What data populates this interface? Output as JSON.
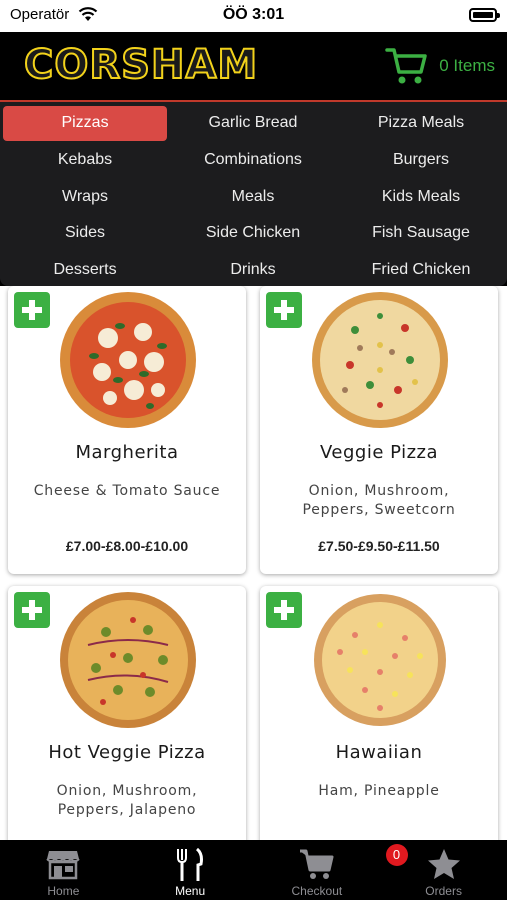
{
  "status_bar": {
    "carrier": "Operatör",
    "time": "ÖÖ 3:01"
  },
  "header": {
    "brand": "CORSHAM",
    "cart_count_text": "0 Items"
  },
  "categories": [
    {
      "label": "Pizzas",
      "active": true
    },
    {
      "label": "Garlic Bread"
    },
    {
      "label": "Pizza Meals"
    },
    {
      "label": "Kebabs"
    },
    {
      "label": "Combinations"
    },
    {
      "label": "Burgers"
    },
    {
      "label": "Wraps"
    },
    {
      "label": "Meals"
    },
    {
      "label": "Kids Meals"
    },
    {
      "label": "Sides"
    },
    {
      "label": "Side Chicken"
    },
    {
      "label": "Fish Sausage"
    },
    {
      "label": "Desserts"
    },
    {
      "label": "Drinks"
    },
    {
      "label": "Fried Chicken"
    }
  ],
  "products": [
    {
      "name": "Margherita",
      "description": "Cheese & Tomato Sauce",
      "price": "£7.00-£8.00-£10.00",
      "image": "margherita-pizza"
    },
    {
      "name": "Veggie Pizza",
      "description": "Onion, Mushroom, Peppers, Sweetcorn",
      "price": "£7.50-£9.50-£11.50",
      "image": "veggie-pizza"
    },
    {
      "name": "Hot Veggie Pizza",
      "description": "Onion, Mushroom, Peppers, Jalapeno",
      "price": "",
      "image": "hot-veggie-pizza"
    },
    {
      "name": "Hawaiian",
      "description": "Ham, Pineapple",
      "price": "",
      "image": "hawaiian-pizza"
    }
  ],
  "tab_bar": {
    "items": [
      {
        "label": "Home",
        "icon": "store-icon"
      },
      {
        "label": "Menu",
        "icon": "fork-knife-icon",
        "active": true
      },
      {
        "label": "Checkout",
        "icon": "cart-icon",
        "badge": "0"
      },
      {
        "label": "Orders",
        "icon": "star-icon"
      }
    ]
  },
  "colors": {
    "accent_green": "#3cb043",
    "active_category": "#d94a45",
    "brand_yellow": "#f2d21b",
    "badge_red": "#e0191f"
  }
}
